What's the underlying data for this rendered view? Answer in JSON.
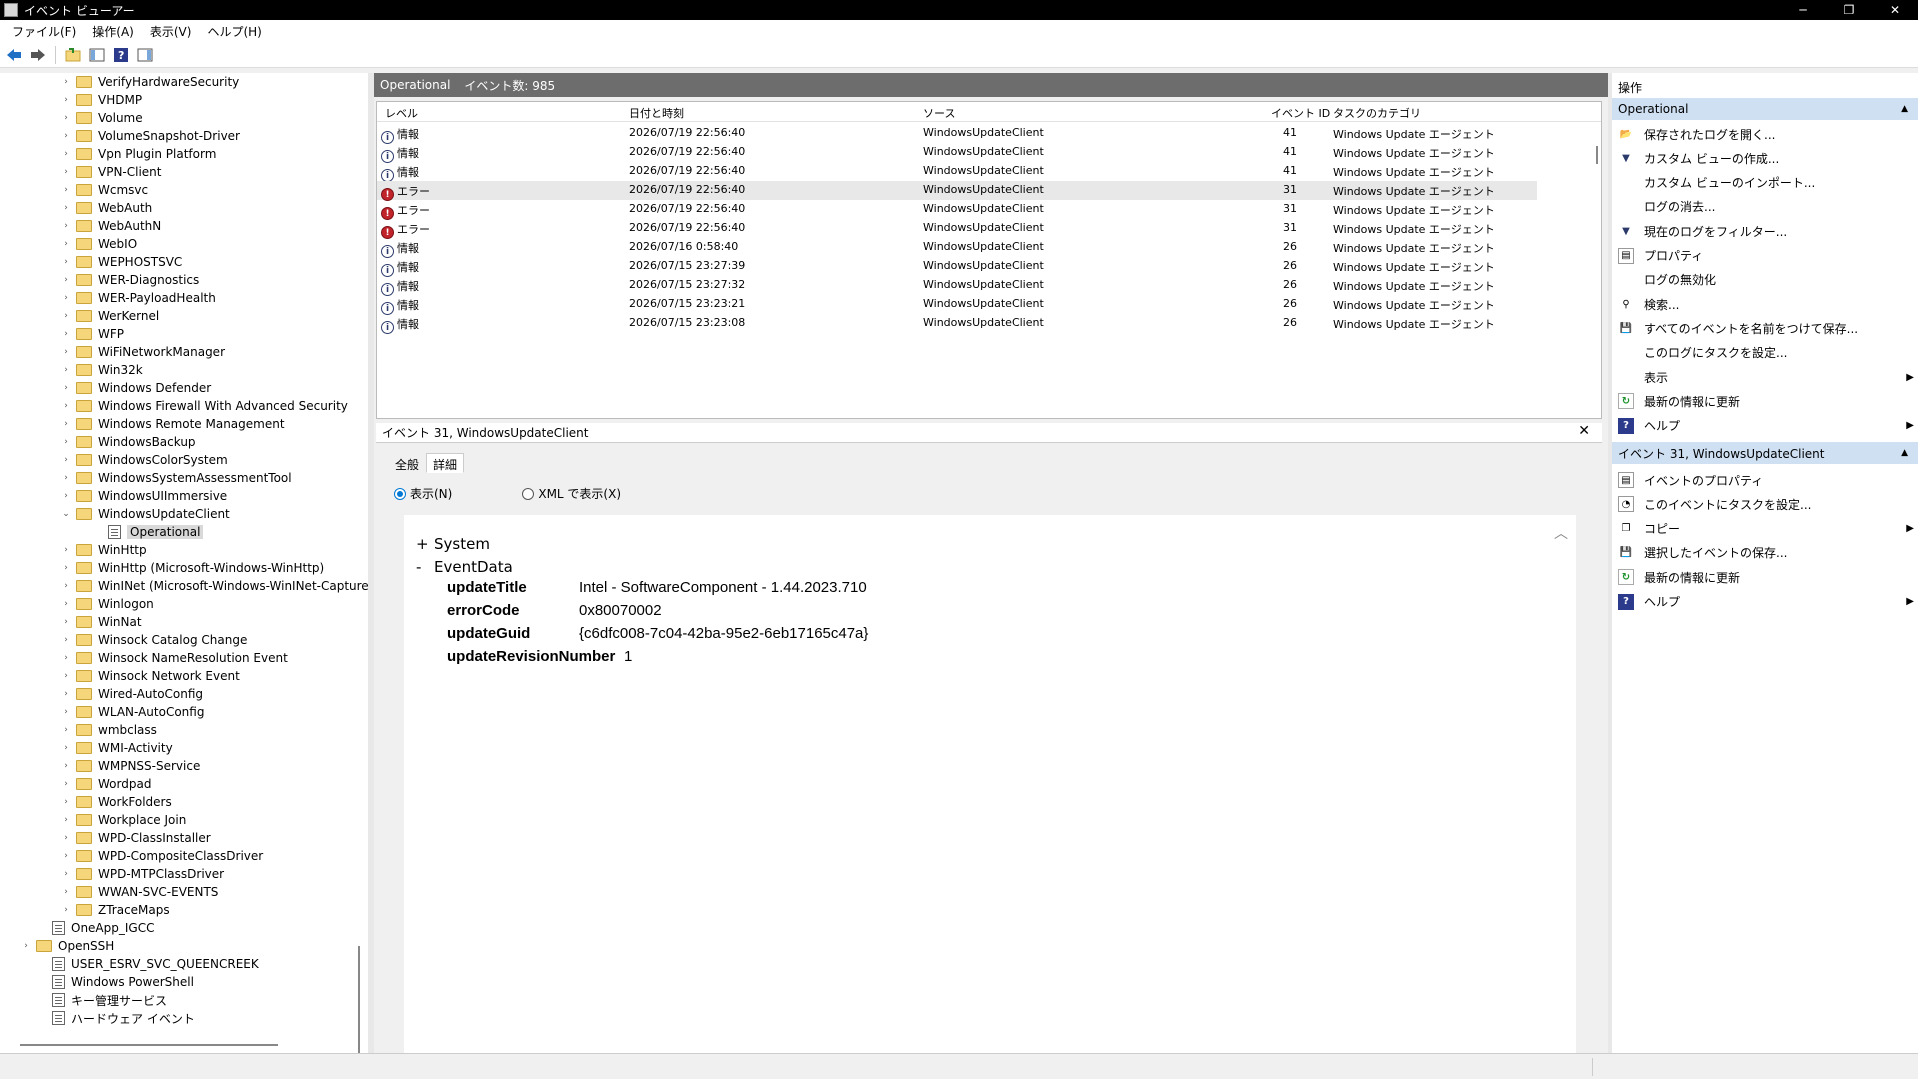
{
  "window": {
    "title": "イベント ビューアー",
    "min": "─",
    "max": "❐",
    "close": "✕"
  },
  "menu": [
    "ファイル(F)",
    "操作(A)",
    "表示(V)",
    "ヘルプ(H)"
  ],
  "tree": {
    "items": [
      {
        "label": "VerifyHardwareSecurity",
        "indent": 2,
        "type": "folder",
        "expand": "›"
      },
      {
        "label": "VHDMP",
        "indent": 2,
        "type": "folder",
        "expand": "›"
      },
      {
        "label": "Volume",
        "indent": 2,
        "type": "folder",
        "expand": "›"
      },
      {
        "label": "VolumeSnapshot-Driver",
        "indent": 2,
        "type": "folder",
        "expand": "›"
      },
      {
        "label": "Vpn Plugin Platform",
        "indent": 2,
        "type": "folder",
        "expand": "›"
      },
      {
        "label": "VPN-Client",
        "indent": 2,
        "type": "folder",
        "expand": "›"
      },
      {
        "label": "Wcmsvc",
        "indent": 2,
        "type": "folder",
        "expand": "›"
      },
      {
        "label": "WebAuth",
        "indent": 2,
        "type": "folder",
        "expand": "›"
      },
      {
        "label": "WebAuthN",
        "indent": 2,
        "type": "folder",
        "expand": "›"
      },
      {
        "label": "WebIO",
        "indent": 2,
        "type": "folder",
        "expand": "›"
      },
      {
        "label": "WEPHOSTSVC",
        "indent": 2,
        "type": "folder",
        "expand": "›"
      },
      {
        "label": "WER-Diagnostics",
        "indent": 2,
        "type": "folder",
        "expand": "›"
      },
      {
        "label": "WER-PayloadHealth",
        "indent": 2,
        "type": "folder",
        "expand": "›"
      },
      {
        "label": "WerKernel",
        "indent": 2,
        "type": "folder",
        "expand": "›"
      },
      {
        "label": "WFP",
        "indent": 2,
        "type": "folder",
        "expand": "›"
      },
      {
        "label": "WiFiNetworkManager",
        "indent": 2,
        "type": "folder",
        "expand": "›"
      },
      {
        "label": "Win32k",
        "indent": 2,
        "type": "folder",
        "expand": "›"
      },
      {
        "label": "Windows Defender",
        "indent": 2,
        "type": "folder",
        "expand": "›"
      },
      {
        "label": "Windows Firewall With Advanced Security",
        "indent": 2,
        "type": "folder",
        "expand": "›"
      },
      {
        "label": "Windows Remote Management",
        "indent": 2,
        "type": "folder",
        "expand": "›"
      },
      {
        "label": "WindowsBackup",
        "indent": 2,
        "type": "folder",
        "expand": "›"
      },
      {
        "label": "WindowsColorSystem",
        "indent": 2,
        "type": "folder",
        "expand": "›"
      },
      {
        "label": "WindowsSystemAssessmentTool",
        "indent": 2,
        "type": "folder",
        "expand": "›"
      },
      {
        "label": "WindowsUIImmersive",
        "indent": 2,
        "type": "folder",
        "expand": "›"
      },
      {
        "label": "WindowsUpdateClient",
        "indent": 2,
        "type": "folder",
        "expand": "⌄"
      },
      {
        "label": "Operational",
        "indent": 3,
        "type": "log",
        "expand": "",
        "selected": true
      },
      {
        "label": "WinHttp",
        "indent": 2,
        "type": "folder",
        "expand": "›"
      },
      {
        "label": "WinHttp (Microsoft-Windows-WinHttp)",
        "indent": 2,
        "type": "folder",
        "expand": "›"
      },
      {
        "label": "WinINet (Microsoft-Windows-WinINet-Capture",
        "indent": 2,
        "type": "folder",
        "expand": "›"
      },
      {
        "label": "Winlogon",
        "indent": 2,
        "type": "folder",
        "expand": "›"
      },
      {
        "label": "WinNat",
        "indent": 2,
        "type": "folder",
        "expand": "›"
      },
      {
        "label": "Winsock Catalog Change",
        "indent": 2,
        "type": "folder",
        "expand": "›"
      },
      {
        "label": "Winsock NameResolution Event",
        "indent": 2,
        "type": "folder",
        "expand": "›"
      },
      {
        "label": "Winsock Network Event",
        "indent": 2,
        "type": "folder",
        "expand": "›"
      },
      {
        "label": "Wired-AutoConfig",
        "indent": 2,
        "type": "folder",
        "expand": "›"
      },
      {
        "label": "WLAN-AutoConfig",
        "indent": 2,
        "type": "folder",
        "expand": "›"
      },
      {
        "label": "wmbclass",
        "indent": 2,
        "type": "folder",
        "expand": "›"
      },
      {
        "label": "WMI-Activity",
        "indent": 2,
        "type": "folder",
        "expand": "›"
      },
      {
        "label": "WMPNSS-Service",
        "indent": 2,
        "type": "folder",
        "expand": "›"
      },
      {
        "label": "Wordpad",
        "indent": 2,
        "type": "folder",
        "expand": "›"
      },
      {
        "label": "WorkFolders",
        "indent": 2,
        "type": "folder",
        "expand": "›"
      },
      {
        "label": "Workplace Join",
        "indent": 2,
        "type": "folder",
        "expand": "›"
      },
      {
        "label": "WPD-ClassInstaller",
        "indent": 2,
        "type": "folder",
        "expand": "›"
      },
      {
        "label": "WPD-CompositeClassDriver",
        "indent": 2,
        "type": "folder",
        "expand": "›"
      },
      {
        "label": "WPD-MTPClassDriver",
        "indent": 2,
        "type": "folder",
        "expand": "›"
      },
      {
        "label": "WWAN-SVC-EVENTS",
        "indent": 2,
        "type": "folder",
        "expand": "›"
      },
      {
        "label": "ZTraceMaps",
        "indent": 2,
        "type": "folder",
        "expand": "›"
      },
      {
        "label": "OneApp_IGCC",
        "indent": 1,
        "type": "log",
        "expand": ""
      },
      {
        "label": "OpenSSH",
        "indent": 0,
        "type": "folder",
        "expand": "›"
      },
      {
        "label": "USER_ESRV_SVC_QUEENCREEK",
        "indent": 1,
        "type": "log",
        "expand": ""
      },
      {
        "label": "Windows PowerShell",
        "indent": 1,
        "type": "log",
        "expand": ""
      },
      {
        "label": "キー管理サービス",
        "indent": 1,
        "type": "log",
        "expand": ""
      },
      {
        "label": "ハードウェア イベント",
        "indent": 1,
        "type": "log",
        "expand": ""
      }
    ]
  },
  "log": {
    "name": "Operational",
    "count": "イベント数: 985"
  },
  "grid": {
    "columns": [
      "レベル",
      "日付と時刻",
      "ソース",
      "イベント ID",
      "タスクのカテゴリ"
    ],
    "rows": [
      {
        "level": "情報",
        "type": "info",
        "date": "2026/07/19 22:56:40",
        "source": "WindowsUpdateClient",
        "id": "41",
        "task": "Windows Update エージェント"
      },
      {
        "level": "情報",
        "type": "info",
        "date": "2026/07/19 22:56:40",
        "source": "WindowsUpdateClient",
        "id": "41",
        "task": "Windows Update エージェント"
      },
      {
        "level": "情報",
        "type": "info",
        "date": "2026/07/19 22:56:40",
        "source": "WindowsUpdateClient",
        "id": "41",
        "task": "Windows Update エージェント"
      },
      {
        "level": "エラー",
        "type": "err",
        "date": "2026/07/19 22:56:40",
        "source": "WindowsUpdateClient",
        "id": "31",
        "task": "Windows Update エージェント",
        "highlight": true
      },
      {
        "level": "エラー",
        "type": "err",
        "date": "2026/07/19 22:56:40",
        "source": "WindowsUpdateClient",
        "id": "31",
        "task": "Windows Update エージェント"
      },
      {
        "level": "エラー",
        "type": "err",
        "date": "2026/07/19 22:56:40",
        "source": "WindowsUpdateClient",
        "id": "31",
        "task": "Windows Update エージェント"
      },
      {
        "level": "情報",
        "type": "info",
        "date": "2026/07/16 0:58:40",
        "source": "WindowsUpdateClient",
        "id": "26",
        "task": "Windows Update エージェント"
      },
      {
        "level": "情報",
        "type": "info",
        "date": "2026/07/15 23:27:39",
        "source": "WindowsUpdateClient",
        "id": "26",
        "task": "Windows Update エージェント"
      },
      {
        "level": "情報",
        "type": "info",
        "date": "2026/07/15 23:27:32",
        "source": "WindowsUpdateClient",
        "id": "26",
        "task": "Windows Update エージェント"
      },
      {
        "level": "情報",
        "type": "info",
        "date": "2026/07/15 23:23:21",
        "source": "WindowsUpdateClient",
        "id": "26",
        "task": "Windows Update エージェント"
      },
      {
        "level": "情報",
        "type": "info",
        "date": "2026/07/15 23:23:08",
        "source": "WindowsUpdateClient",
        "id": "26",
        "task": "Windows Update エージェント"
      }
    ]
  },
  "detail": {
    "title": "イベント 31, WindowsUpdateClient",
    "close": "✕",
    "tabs": [
      "全般",
      "詳細"
    ],
    "active_tab": 1,
    "radio_friendly": "表示(N)",
    "radio_xml": "XML で表示(X)",
    "system_toggle": "+",
    "system_label": "System",
    "eventdata_toggle": "-",
    "eventdata_label": "EventData",
    "fields": [
      {
        "key": "updateTitle",
        "value": "Intel - SoftwareComponent - 1.44.2023.710"
      },
      {
        "key": "errorCode",
        "value": "0x80070002"
      },
      {
        "key": "updateGuid",
        "value": "{c6dfc008-7c04-42ba-95e2-6eb17165c47a}"
      },
      {
        "key": "updateRevisionNumber",
        "value": "1"
      }
    ]
  },
  "actions": {
    "title": "操作",
    "section1": "Operational",
    "items1": [
      {
        "label": "保存されたログを開く...",
        "icon": "open-folder-icon",
        "glyph": "📂",
        "cls": ""
      },
      {
        "label": "カスタム ビューの作成...",
        "icon": "filter-icon",
        "glyph": "▼",
        "cls": "i-filter"
      },
      {
        "label": "カスタム ビューのインポート...",
        "icon": "",
        "glyph": "",
        "cls": ""
      },
      {
        "label": "ログの消去...",
        "icon": "",
        "glyph": "",
        "cls": ""
      },
      {
        "label": "現在のログをフィルター...",
        "icon": "filter-icon",
        "glyph": "▼",
        "cls": "i-filter"
      },
      {
        "label": "プロパティ",
        "icon": "properties-icon",
        "glyph": "▤",
        "cls": "i-gen"
      },
      {
        "label": "ログの無効化",
        "icon": "",
        "glyph": "",
        "cls": ""
      },
      {
        "label": "検索...",
        "icon": "binoculars-icon",
        "glyph": "⚲",
        "cls": ""
      },
      {
        "label": "すべてのイベントを名前をつけて保存...",
        "icon": "save-icon",
        "glyph": "💾",
        "cls": "i-save"
      },
      {
        "label": "このログにタスクを設定...",
        "icon": "",
        "glyph": "",
        "cls": ""
      },
      {
        "label": "表示",
        "icon": "",
        "glyph": "",
        "cls": "",
        "submenu": true
      },
      {
        "label": "最新の情報に更新",
        "icon": "refresh-icon",
        "glyph": "↻",
        "cls": "i-refresh"
      },
      {
        "label": "ヘルプ",
        "icon": "help-icon",
        "glyph": "?",
        "cls": "i-help",
        "submenu": true
      }
    ],
    "section2": "イベント 31, WindowsUpdateClient",
    "items2": [
      {
        "label": "イベントのプロパティ",
        "icon": "properties-icon",
        "glyph": "▤",
        "cls": "i-gen"
      },
      {
        "label": "このイベントにタスクを設定...",
        "icon": "task-icon",
        "glyph": "◔",
        "cls": "i-gen"
      },
      {
        "label": "コピー",
        "icon": "copy-icon",
        "glyph": "❐",
        "cls": "",
        "submenu": true
      },
      {
        "label": "選択したイベントの保存...",
        "icon": "save-icon",
        "glyph": "💾",
        "cls": "i-save"
      },
      {
        "label": "最新の情報に更新",
        "icon": "refresh-icon",
        "glyph": "↻",
        "cls": "i-refresh"
      },
      {
        "label": "ヘルプ",
        "icon": "help-icon",
        "glyph": "?",
        "cls": "i-help",
        "submenu": true
      }
    ]
  }
}
